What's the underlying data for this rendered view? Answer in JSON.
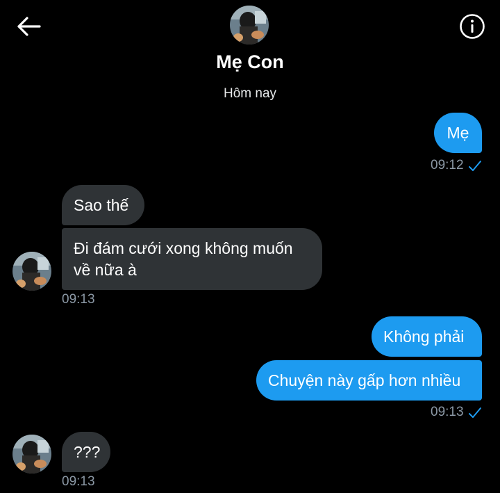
{
  "header": {
    "back_icon": "arrow-left-icon",
    "info_icon": "info-icon",
    "contact_name": "Mẹ Con"
  },
  "conversation": {
    "date_separator": "Hôm nay",
    "messages": [
      {
        "direction": "outgoing",
        "text": "Mẹ",
        "time": "09:12",
        "status_icon": "check-icon"
      },
      {
        "direction": "incoming",
        "text": "Sao thế"
      },
      {
        "direction": "incoming",
        "text": "Đi đám cưới xong không muốn về nữa à",
        "time": "09:13"
      },
      {
        "direction": "outgoing",
        "text": "Không phải"
      },
      {
        "direction": "outgoing",
        "text": "Chuyện này gấp hơn nhiều",
        "time": "09:13",
        "status_icon": "check-icon"
      },
      {
        "direction": "incoming",
        "text": "???",
        "time": "09:13"
      }
    ]
  },
  "colors": {
    "background": "#000000",
    "outgoing_bubble": "#1d9bf0",
    "incoming_bubble": "#2f3336",
    "timestamp": "#8b98a5",
    "check": "#1d9bf0"
  }
}
